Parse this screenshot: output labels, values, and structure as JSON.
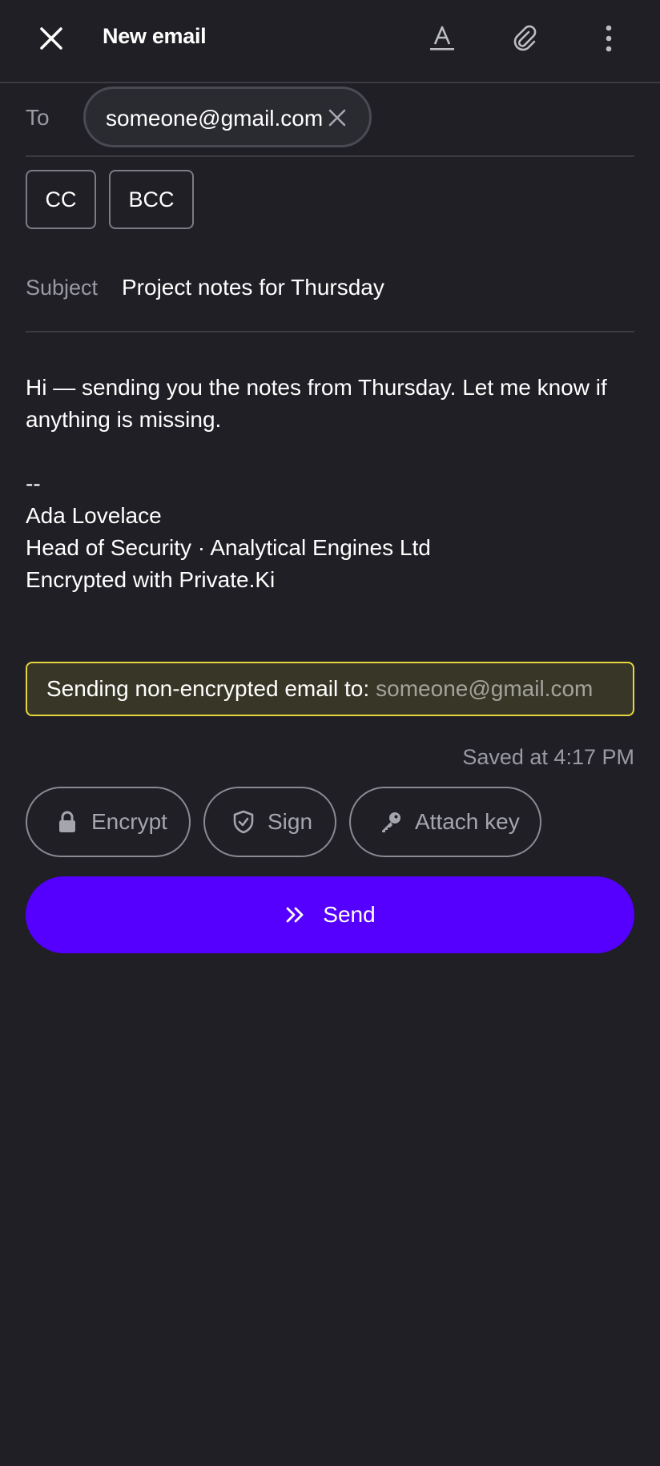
{
  "header": {
    "title": "New email",
    "icons": [
      "close-icon",
      "text-format-icon",
      "attachment-icon",
      "more-vert-icon"
    ]
  },
  "to": {
    "label": "To",
    "recipients": [
      {
        "address": "someone@gmail.com"
      }
    ]
  },
  "cc_label": "CC",
  "bcc_label": "BCC",
  "subject": {
    "label": "Subject",
    "value": "Project notes for Thursday"
  },
  "body": {
    "lines": [
      "Hi — sending you the notes from Thursday. Let me know if",
      "anything is missing.",
      "",
      "--",
      "Ada Lovelace",
      "Head of Security · Analytical Engines Ltd",
      "Encrypted with Private.Ki"
    ]
  },
  "warning": {
    "label": "Sending non-encrypted email to:",
    "address": "someone@gmail.com",
    "border_color": "#e6d640"
  },
  "saved_status": "Saved at 4:17 PM",
  "options": {
    "encrypt": {
      "label": "Encrypt",
      "icon": "lock-icon"
    },
    "sign": {
      "label": "Sign",
      "icon": "shield-check-icon"
    },
    "attach_key": {
      "label": "Attach key",
      "icon": "key-icon"
    }
  },
  "send": {
    "label": "Send",
    "icon": "double-chevron-right-icon",
    "color": "#5500ff"
  }
}
